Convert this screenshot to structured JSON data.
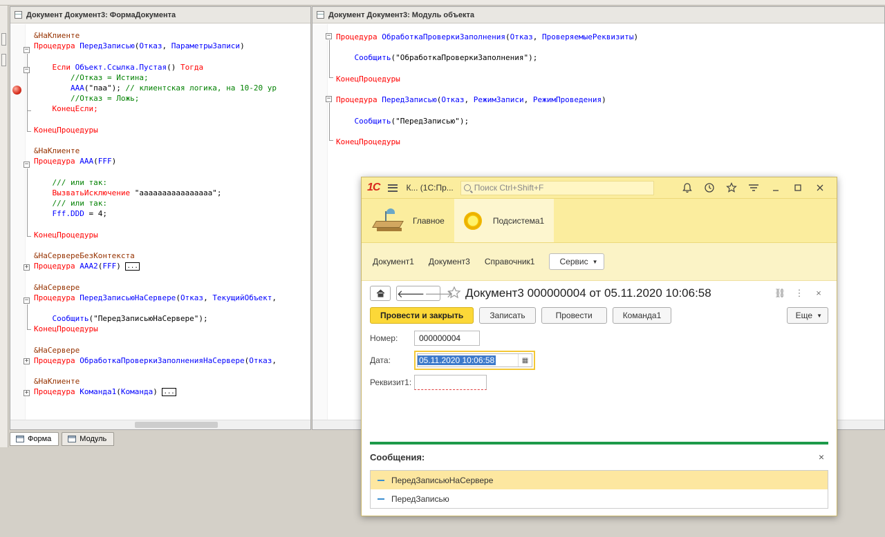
{
  "left_window": {
    "title": "Документ Документ3: ФормаДокумента",
    "code_lines": [
      [
        [
          "dr",
          "&НаКлиенте"
        ]
      ],
      [
        [
          "kw",
          "Процедура "
        ],
        [
          "id",
          "ПередЗаписью"
        ],
        [
          "st",
          "("
        ],
        [
          "id",
          "Отказ"
        ],
        [
          "st",
          ", "
        ],
        [
          "id",
          "ПараметрыЗаписи"
        ],
        [
          "st",
          ")"
        ]
      ],
      [],
      [
        [
          "st",
          "    "
        ],
        [
          "kw",
          "Если "
        ],
        [
          "id",
          "Объект.Ссылка.Пустая"
        ],
        [
          "st",
          "() "
        ],
        [
          "kw",
          "Тогда"
        ]
      ],
      [
        [
          "st",
          "        "
        ],
        [
          "cm",
          "//Отказ = Истина;"
        ]
      ],
      [
        [
          "st",
          "        "
        ],
        [
          "id",
          "ААА"
        ],
        [
          "st",
          "(\"паа\"); "
        ],
        [
          "cm",
          "// клиентская логика, на 10-20 ур"
        ]
      ],
      [
        [
          "st",
          "        "
        ],
        [
          "cm",
          "//Отказ = Ложь;"
        ]
      ],
      [
        [
          "st",
          "    "
        ],
        [
          "kw",
          "КонецЕсли;"
        ]
      ],
      [],
      [
        [
          "kw",
          "КонецПроцедуры"
        ]
      ],
      [],
      [
        [
          "dr",
          "&НаКлиенте"
        ]
      ],
      [
        [
          "kw",
          "Процедура "
        ],
        [
          "id",
          "ААА"
        ],
        [
          "st",
          "("
        ],
        [
          "id",
          "FFF"
        ],
        [
          "st",
          ")"
        ]
      ],
      [],
      [
        [
          "st",
          "    "
        ],
        [
          "cm",
          "/// или так:"
        ]
      ],
      [
        [
          "st",
          "    "
        ],
        [
          "kw",
          "ВызватьИсключение "
        ],
        [
          "st",
          "\"аааааааааааааааа\";"
        ]
      ],
      [
        [
          "st",
          "    "
        ],
        [
          "cm",
          "/// или так:"
        ]
      ],
      [
        [
          "st",
          "    "
        ],
        [
          "id",
          "Fff.DDD"
        ],
        [
          "st",
          " = 4;"
        ]
      ],
      [],
      [
        [
          "kw",
          "КонецПроцедуры"
        ]
      ],
      [],
      [
        [
          "dr",
          "&НаСервереБезКонтекста"
        ]
      ],
      [
        [
          "kw",
          "Процедура "
        ],
        [
          "id",
          "ААА2"
        ],
        [
          "st",
          "("
        ],
        [
          "id",
          "FFF"
        ],
        [
          "st",
          ") "
        ],
        [
          "box",
          "..."
        ]
      ],
      [],
      [
        [
          "dr",
          "&НаСервере"
        ]
      ],
      [
        [
          "kw",
          "Процедура "
        ],
        [
          "id",
          "ПередЗаписьюНаСервере"
        ],
        [
          "st",
          "("
        ],
        [
          "id",
          "Отказ"
        ],
        [
          "st",
          ", "
        ],
        [
          "id",
          "ТекущийОбъект"
        ],
        [
          "st",
          ","
        ]
      ],
      [],
      [
        [
          "st",
          "    "
        ],
        [
          "id",
          "Сообщить"
        ],
        [
          "st",
          "(\"ПередЗаписьюНаСервере\");"
        ]
      ],
      [
        [
          "kw",
          "КонецПроцедуры"
        ]
      ],
      [],
      [
        [
          "dr",
          "&НаСервере"
        ]
      ],
      [
        [
          "kw",
          "Процедура "
        ],
        [
          "id",
          "ОбработкаПроверкиЗаполненияНаСервере"
        ],
        [
          "st",
          "("
        ],
        [
          "id",
          "Отказ"
        ],
        [
          "st",
          ","
        ]
      ],
      [],
      [
        [
          "dr",
          "&НаКлиенте"
        ]
      ],
      [
        [
          "kw",
          "Процедура "
        ],
        [
          "id",
          "Команда1"
        ],
        [
          "st",
          "("
        ],
        [
          "id",
          "Команда"
        ],
        [
          "st",
          ") "
        ],
        [
          "box",
          "..."
        ]
      ]
    ]
  },
  "right_window": {
    "title": "Документ Документ3: Модуль объекта",
    "code_lines": [
      [
        [
          "kw",
          "Процедура "
        ],
        [
          "id",
          "ОбработкаПроверкиЗаполнения"
        ],
        [
          "st",
          "("
        ],
        [
          "id",
          "Отказ"
        ],
        [
          "st",
          ", "
        ],
        [
          "id",
          "ПроверяемыеРеквизиты"
        ],
        [
          "st",
          ")"
        ]
      ],
      [],
      [
        [
          "st",
          "    "
        ],
        [
          "id",
          "Сообщить"
        ],
        [
          "st",
          "(\"ОбработкаПроверкиЗаполнения\");"
        ]
      ],
      [],
      [
        [
          "kw",
          "КонецПроцедуры"
        ]
      ],
      [],
      [
        [
          "kw",
          "Процедура "
        ],
        [
          "id",
          "ПередЗаписью"
        ],
        [
          "st",
          "("
        ],
        [
          "id",
          "Отказ"
        ],
        [
          "st",
          ", "
        ],
        [
          "id",
          "РежимЗаписи"
        ],
        [
          "st",
          ", "
        ],
        [
          "id",
          "РежимПроведения"
        ],
        [
          "st",
          ")"
        ]
      ],
      [],
      [
        [
          "st",
          "    "
        ],
        [
          "id",
          "Сообщить"
        ],
        [
          "st",
          "(\"ПередЗаписью\");"
        ]
      ],
      [],
      [
        [
          "kw",
          "КонецПроцедуры"
        ]
      ]
    ]
  },
  "bottom_tabs": [
    "Форма",
    "Модуль"
  ],
  "app": {
    "logo": "1С",
    "title": "К... (1С:Пр...",
    "search_placeholder": "Поиск Ctrl+Shift+F",
    "sections": [
      "Главное",
      "Подсистема1"
    ],
    "nav_links": [
      "Документ1",
      "Документ3",
      "Справочник1"
    ],
    "service_button": "Сервис",
    "form_title": "Документ3 000000004 от 05.11.2020 10:06:58",
    "buttons": {
      "post_close": "Провести и закрыть",
      "save": "Записать",
      "post": "Провести",
      "command1": "Команда1",
      "more": "Еще"
    },
    "fields": {
      "number_label": "Номер:",
      "number_value": "000000004",
      "date_label": "Дата:",
      "date_value": "05.11.2020 10:06:58",
      "attr_label": "Реквизит1:",
      "attr_value": ""
    },
    "messages_title": "Сообщения:",
    "messages": [
      "ПередЗаписьюНаСервере",
      "ПередЗаписью"
    ],
    "colors": {
      "accent_yellow": "#fbed9e",
      "primary_button": "#fcd838",
      "messages_separator": "#1d9a4a"
    }
  }
}
